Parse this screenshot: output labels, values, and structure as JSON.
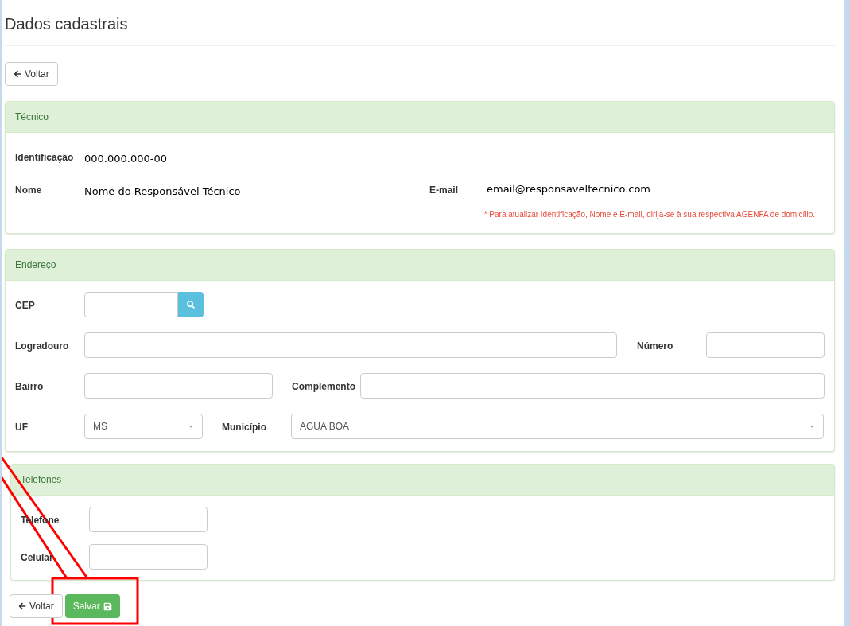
{
  "page_title": "Dados cadastrais",
  "back_button": {
    "label": "Voltar"
  },
  "tecnico": {
    "title": "Técnico",
    "fields": [
      {
        "label": "Identificação",
        "value": "000.000.000-00"
      },
      {
        "label": "Nome",
        "value": "Nome do Responsável Técnico"
      },
      {
        "label": "E-mail",
        "value": "email@responsaveltecnico.com"
      }
    ],
    "notice": "* Para atualizar Identificação, Nome e E-mail, dirija-se à sua respectiva AGENFA de domicílio."
  },
  "endereco": {
    "title": "Endereço",
    "cep": {
      "label": "CEP"
    },
    "logradouro": {
      "label": "Logradouro"
    },
    "numero": {
      "label": "Número"
    },
    "bairro": {
      "label": "Bairro"
    },
    "complemento": {
      "label": "Complemento"
    },
    "uf": {
      "label": "UF",
      "value": "MS"
    },
    "municipio": {
      "label": "Município",
      "value": "AGUA BOA"
    }
  },
  "telefones": {
    "title": "Telefones",
    "fields": [
      {
        "label": "Telefone"
      },
      {
        "label": "Celular"
      }
    ]
  },
  "footer_buttons": [
    {
      "label": "Voltar",
      "kind": "back"
    },
    {
      "label": "Salvar",
      "kind": "save"
    }
  ],
  "annotation": {
    "highlighted": true
  }
}
